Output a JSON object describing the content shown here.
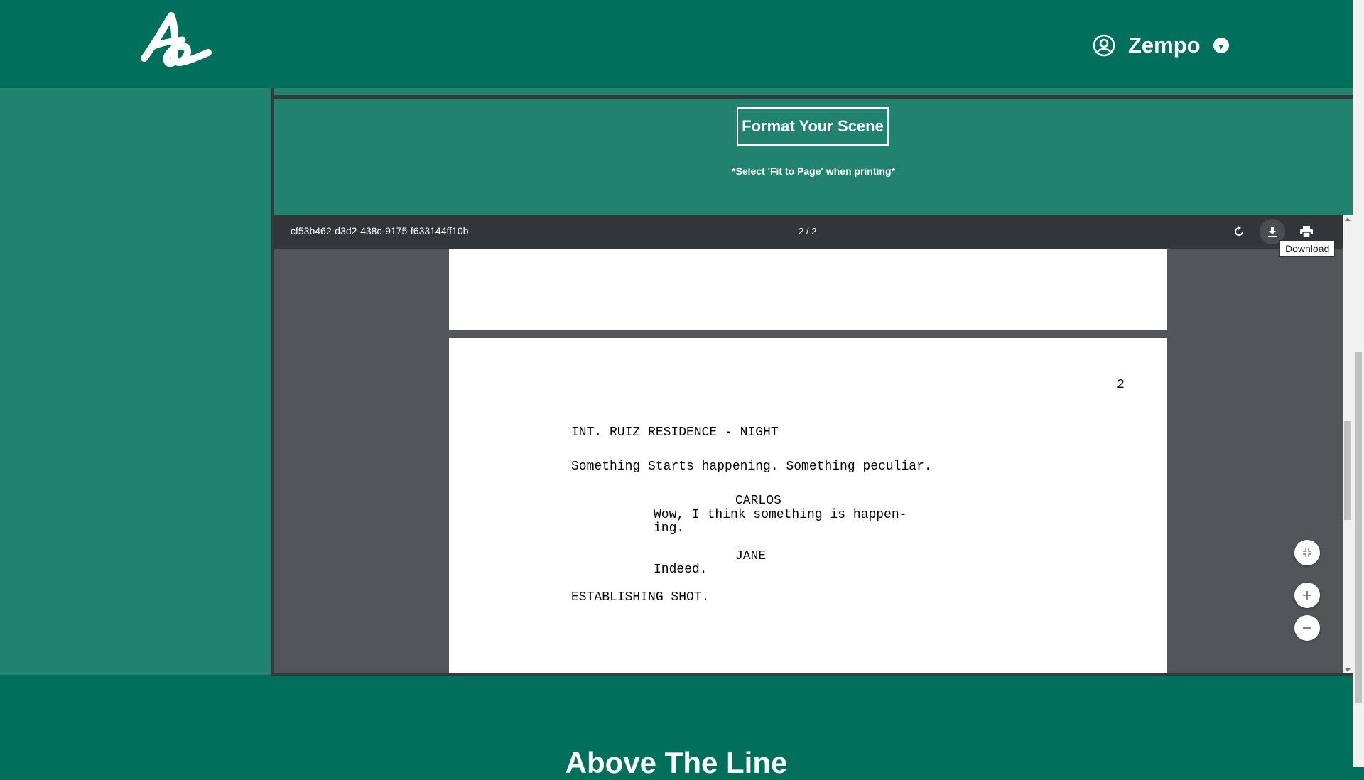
{
  "header": {
    "logo_icon": "script-a-logo-icon",
    "user_icon": "user-circle-icon",
    "user_name": "Zempo",
    "dropdown_icon": "caret-down-icon",
    "dropdown_glyph": "▾"
  },
  "format": {
    "button_label": "Format Your Scene",
    "note": "*Select 'Fit to Page' when printing*"
  },
  "viewer": {
    "document_name": "cf53b462-d3d2-438c-9175-f633144ff10b",
    "page_indicator": "2 / 2",
    "actions": [
      {
        "icon": "rotate-icon"
      },
      {
        "icon": "download-icon"
      },
      {
        "icon": "print-icon"
      }
    ],
    "tooltip": "Download",
    "page2": {
      "page_number": "2",
      "lines": [
        "INT. RUIZ RESIDENCE - NIGHT",
        "Something Starts happening. Something peculiar.",
        "CARLOS",
        "Wow, I think something is happen-",
        "ing.",
        "JANE",
        "Indeed.",
        "ESTABLISHING SHOT."
      ]
    },
    "zoom_controls": [
      {
        "icon": "fit-page-icon"
      },
      {
        "icon": "zoom-in-icon"
      },
      {
        "icon": "zoom-out-icon"
      }
    ]
  },
  "footer": {
    "title": "Above The Line"
  },
  "colors": {
    "brand_green": "#00705d",
    "panel_green": "#218270",
    "toolbar_dark": "#323639",
    "viewer_gray": "#525659"
  }
}
